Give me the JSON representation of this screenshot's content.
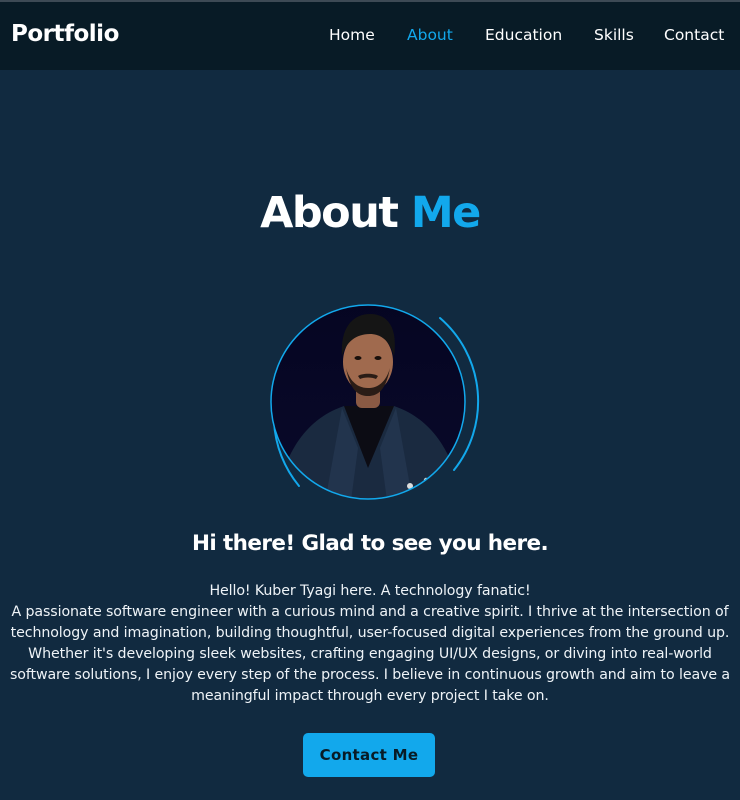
{
  "nav": {
    "brand": "Portfolio",
    "links": [
      {
        "label": "Home",
        "active": false
      },
      {
        "label": "About",
        "active": true
      },
      {
        "label": "Education",
        "active": false
      },
      {
        "label": "Skills",
        "active": false
      },
      {
        "label": "Contact",
        "active": false
      }
    ]
  },
  "about": {
    "title_part1": "About",
    "title_part2": "Me",
    "greeting": "Hi there! Glad to see you here.",
    "intro": "Hello! Kuber Tyagi here. A technology fanatic!",
    "description": "A passionate software engineer with a curious mind and a creative spirit. I thrive at the intersection of technology and imagination, building thoughtful, user-focused digital experiences from the ground up. Whether it's developing sleek websites, crafting engaging UI/UX designs, or diving into real-world software solutions, I enjoy every step of the process. I believe in continuous growth and aim to leave a meaningful impact through every project I take on.",
    "cta_label": "Contact Me"
  },
  "colors": {
    "accent": "#12a8ec",
    "background": "#112a40",
    "navbar": "#081b26"
  }
}
